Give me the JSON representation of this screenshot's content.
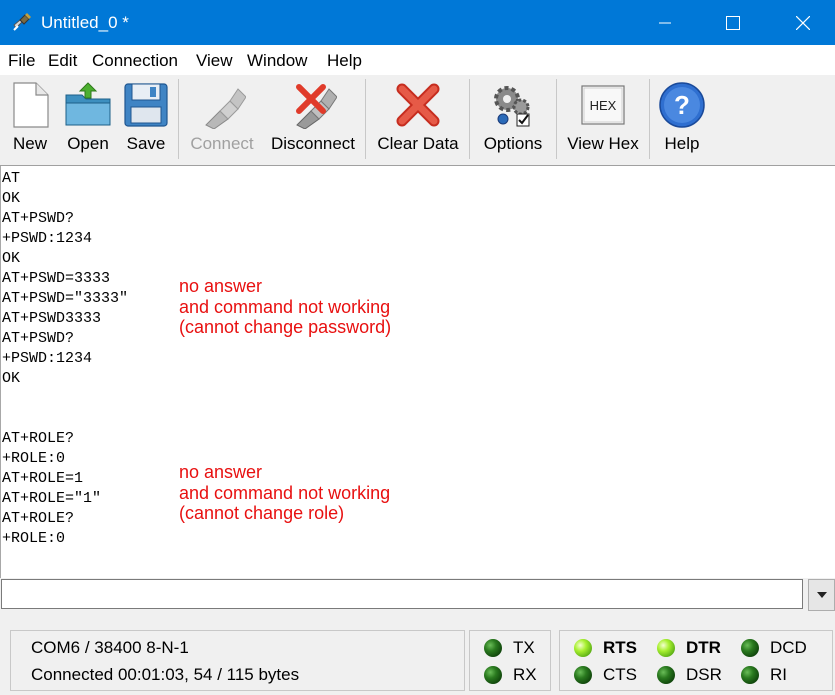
{
  "window": {
    "title": "Untitled_0 *"
  },
  "menu": [
    "File",
    "Edit",
    "Connection",
    "View",
    "Window",
    "Help"
  ],
  "toolbar": {
    "new": "New",
    "open": "Open",
    "save": "Save",
    "connect": "Connect",
    "disconnect": "Disconnect",
    "clear_data": "Clear Data",
    "options": "Options",
    "view_hex": "View Hex",
    "hex_icon_text": "HEX",
    "help": "Help"
  },
  "terminal": {
    "lines": [
      "AT",
      "OK",
      "AT+PSWD?",
      "+PSWD:1234",
      "OK",
      "AT+PSWD=3333",
      "AT+PSWD=\"3333\"",
      "AT+PSWD3333",
      "AT+PSWD?",
      "+PSWD:1234",
      "OK",
      "",
      "",
      "AT+ROLE?",
      "+ROLE:0",
      "AT+ROLE=1",
      "AT+ROLE=\"1\"",
      "AT+ROLE?",
      "+ROLE:0"
    ],
    "note1": [
      "no answer",
      "and command not working",
      "(cannot change password)"
    ],
    "note2": [
      "no answer",
      "and command not working",
      "(cannot change role)"
    ]
  },
  "input": {
    "value": "",
    "placeholder": ""
  },
  "status": {
    "port": "COM6 / 38400 8-N-1",
    "connection": "Connected 00:01:03, 54 / 115 bytes",
    "tx": "TX",
    "rx": "RX",
    "rts": "RTS",
    "cts": "CTS",
    "dtr": "DTR",
    "dsr": "DSR",
    "dcd": "DCD",
    "ri": "RI"
  },
  "colors": {
    "titlebar": "#0078d7",
    "note_text": "#e81010",
    "led_active": "#a8f030",
    "led_inactive": "#2a7a1f"
  }
}
